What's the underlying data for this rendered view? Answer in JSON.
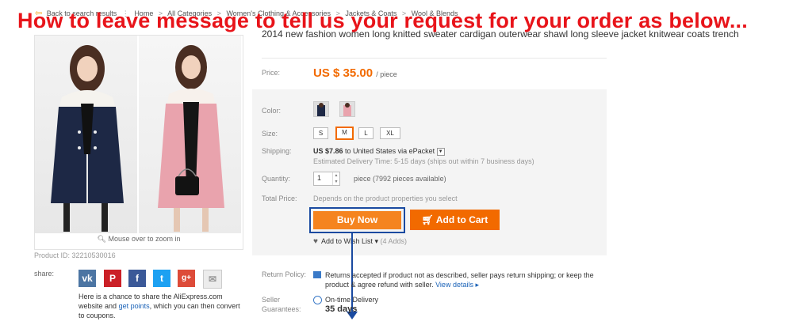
{
  "breadcrumb": {
    "back": "Back to search results",
    "items": [
      "Home",
      "All Categories",
      "Women's Clothing & Accessories",
      "Jackets & Coats",
      "Wool & Blends"
    ]
  },
  "headline": "How to leave message to tell us your request for your order as below...",
  "gallery": {
    "zoom_hint": "Mouse over to zoom in"
  },
  "product": {
    "title": "2014 new fashion women long knitted sweater cardigan outerwear shawl long sleeve jacket knitwear coats trench",
    "price_label": "Price:",
    "price_value": "US $ 35.00",
    "price_unit": "/ piece",
    "color_label": "Color:",
    "size_label": "Size:",
    "sizes": [
      "S",
      "M",
      "L",
      "XL"
    ],
    "selected_size": "M",
    "shipping_label": "Shipping:",
    "shipping_cost": "US $7.86",
    "shipping_dest": "to United States via ePacket",
    "shipping_eta": "Estimated Delivery Time: 5-15 days (ships out within 7 business days)",
    "quantity_label": "Quantity:",
    "quantity_value": "1",
    "quantity_note": "piece (7992 pieces available)",
    "total_label": "Total Price:",
    "total_note": "Depends on the product properties you select",
    "buy_now": "Buy Now",
    "add_to_cart": "Add to Cart",
    "wishlist": "Add to Wish List",
    "wishlist_count": "(4 Adds)",
    "product_id": "Product ID: 32210530016"
  },
  "share": {
    "label": "share:",
    "icons": [
      "vk-icon",
      "pinterest-icon",
      "facebook-icon",
      "twitter-icon",
      "google-plus-icon",
      "email-icon"
    ],
    "text_pre": "Here is a chance to share the AliExpress.com website and",
    "text_link": "get points",
    "text_post": ", which you can then convert to coupons."
  },
  "policy": {
    "return_label": "Return Policy:",
    "return_text": "Returns accepted if product not as described, seller pays return shipping; or keep the product & agree refund with seller.",
    "view_details": "View details ▸",
    "seller_label": "Seller Guarantees:",
    "ontime": "On-time Delivery",
    "days": "35 days"
  },
  "colors": {
    "accent": "#f26a00",
    "headline": "#e8141a",
    "arrow": "#1a4aa0"
  }
}
